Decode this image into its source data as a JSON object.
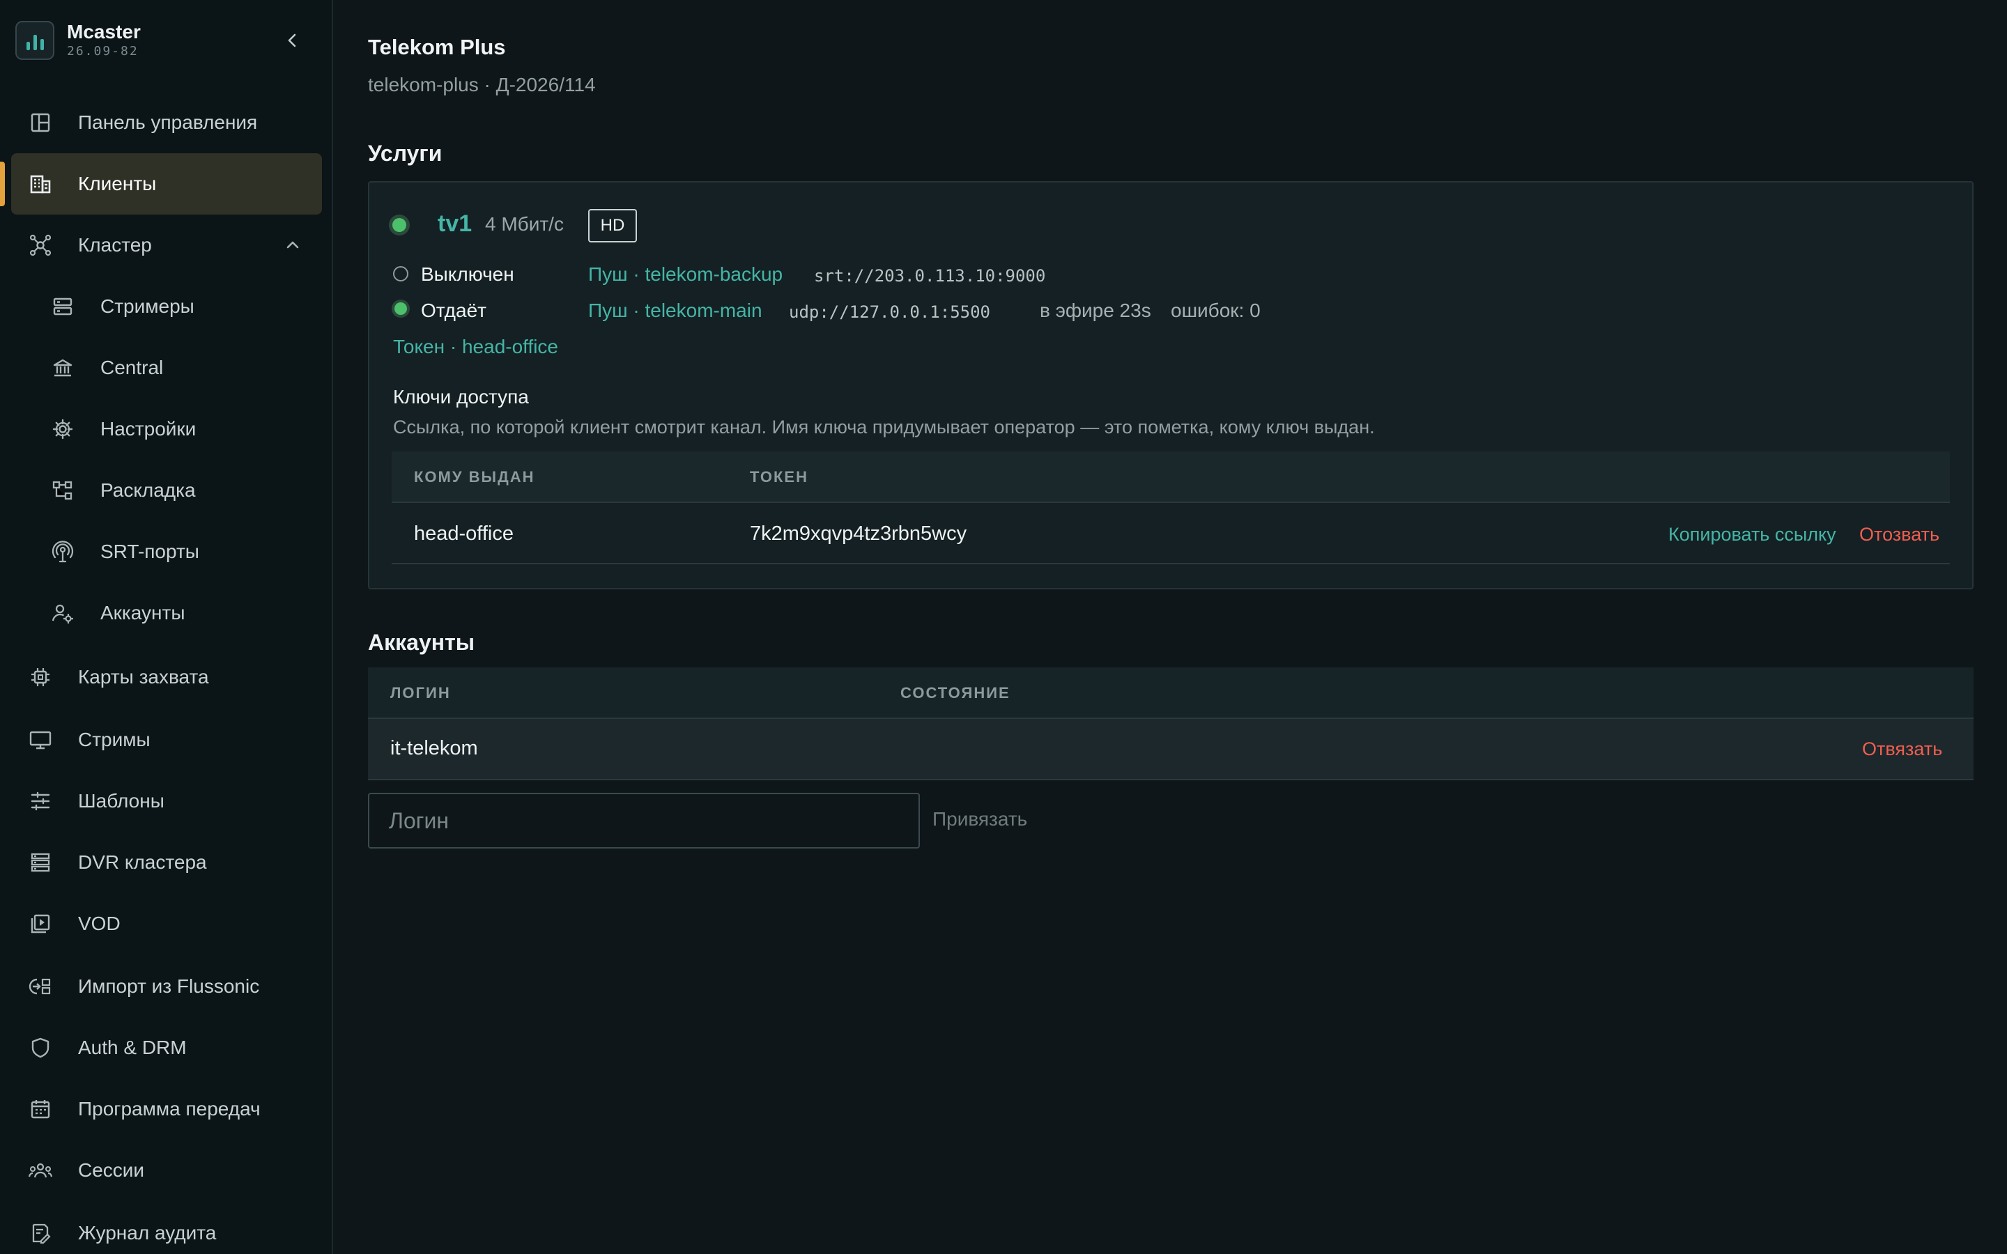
{
  "app": {
    "name": "Mcaster",
    "version": "26.09-82"
  },
  "sidebar": {
    "items": [
      {
        "label": "Панель управления",
        "icon": "dashboard-icon"
      },
      {
        "label": "Клиенты",
        "icon": "building-icon",
        "active": true
      },
      {
        "label": "Кластер",
        "icon": "cluster-icon",
        "expanded": true
      },
      {
        "label": "Стримеры",
        "icon": "server-icon"
      },
      {
        "label": "Central",
        "icon": "bank-icon"
      },
      {
        "label": "Настройки",
        "icon": "gear-icon"
      },
      {
        "label": "Раскладка",
        "icon": "layout-tree-icon"
      },
      {
        "label": "SRT-порты",
        "icon": "antenna-icon"
      },
      {
        "label": "Аккаунты",
        "icon": "user-gear-icon"
      },
      {
        "label": "Карты захвата",
        "icon": "chip-icon"
      },
      {
        "label": "Стримы",
        "icon": "monitor-icon"
      },
      {
        "label": "Шаблоны",
        "icon": "sliders-icon"
      },
      {
        "label": "DVR кластера",
        "icon": "storage-icon"
      },
      {
        "label": "VOD",
        "icon": "video-library-icon"
      },
      {
        "label": "Импорт из Flussonic",
        "icon": "import-icon"
      },
      {
        "label": "Auth & DRM",
        "icon": "shield-icon"
      },
      {
        "label": "Программа передач",
        "icon": "calendar-icon"
      },
      {
        "label": "Сессии",
        "icon": "users-icon"
      },
      {
        "label": "Журнал аудита",
        "icon": "audit-icon"
      }
    ]
  },
  "client": {
    "title": "Telekom Plus",
    "subtitle": "telekom-plus · Д-2026/114"
  },
  "services": {
    "heading": "Услуги",
    "service": {
      "name": "tv1",
      "rate": "4 Мбит/с",
      "badge": "HD",
      "status_color": "#4cc06a",
      "outputs": [
        {
          "state": "Выключен",
          "target": "Пуш · telekom-backup",
          "url": "srt://203.0.113.10:9000"
        },
        {
          "state": "Отдаёт",
          "target": "Пуш · telekom-main",
          "url": "udp://127.0.0.1:5500",
          "uptime": "в эфире 23s",
          "errors": "ошибок: 0"
        }
      ],
      "token_link": "Токен · head-office"
    },
    "keys": {
      "title": "Ключи доступа",
      "description": "Ссылка, по которой клиент смотрит канал. Имя ключа придумывает оператор — это пометка, кому ключ выдан.",
      "columns": [
        "КОМУ ВЫДАН",
        "ТОКЕН"
      ],
      "rows": [
        {
          "issued_to": "head-office",
          "token": "7k2m9xqvp4tz3rbn5wcy",
          "copy": "Копировать ссылку",
          "revoke": "Отозвать"
        }
      ]
    }
  },
  "accounts": {
    "heading": "Аккаунты",
    "columns": [
      "ЛОГИН",
      "СОСТОЯНИЕ"
    ],
    "rows": [
      {
        "login": "it-telekom",
        "state": "",
        "unbind": "Отвязать"
      }
    ],
    "input_placeholder": "Логин",
    "bind_label": "Привязать"
  },
  "colors": {
    "accent": "#45b5a7",
    "danger": "#ef5e50",
    "active": "#e3a23b",
    "ok": "#4cc06a"
  }
}
